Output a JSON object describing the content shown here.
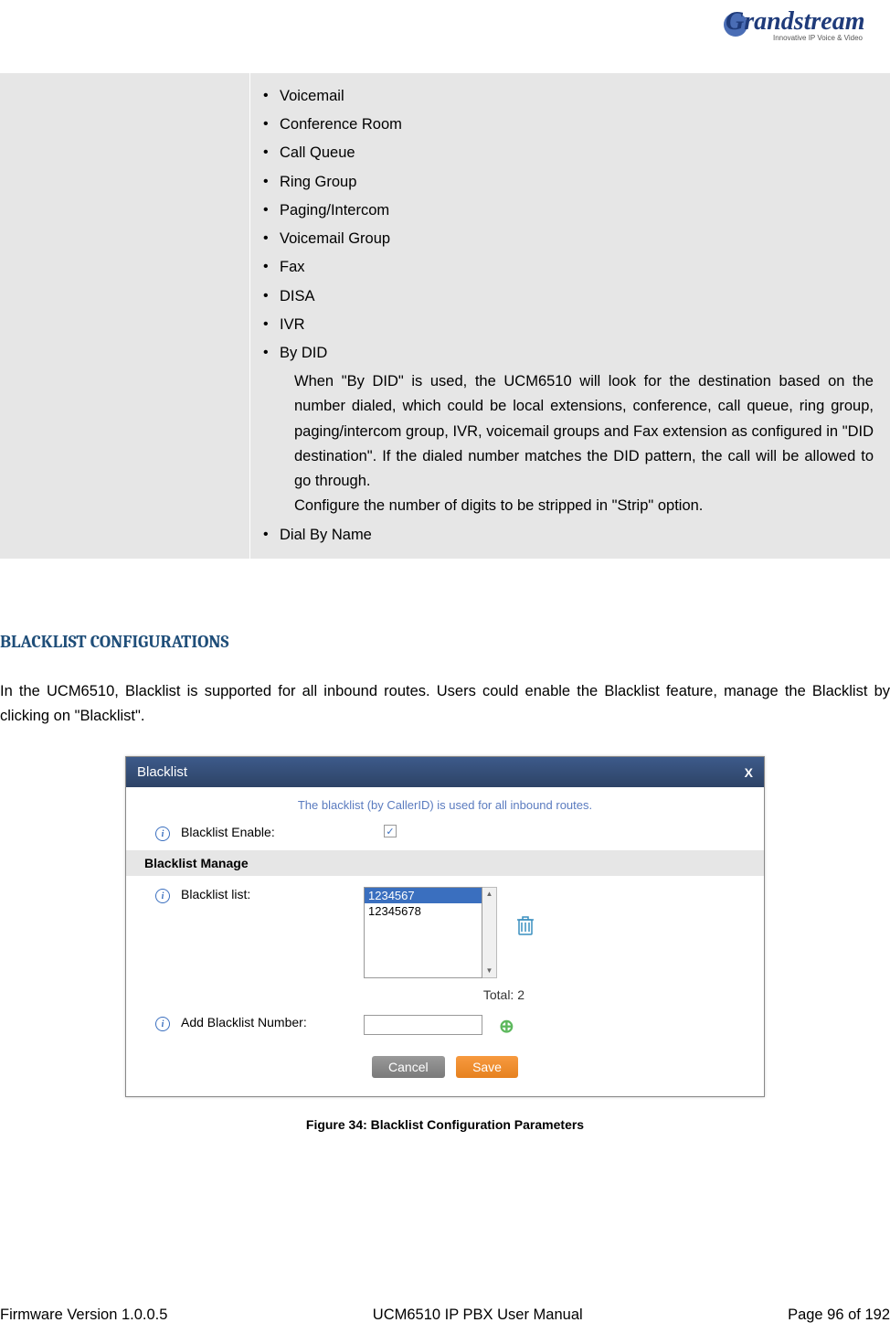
{
  "logo": {
    "brand": "Grandstream",
    "tagline": "Innovative IP Voice & Video"
  },
  "bullet_items": [
    {
      "label": "Voicemail"
    },
    {
      "label": "Conference Room"
    },
    {
      "label": "Call Queue"
    },
    {
      "label": "Ring Group"
    },
    {
      "label": "Paging/Intercom"
    },
    {
      "label": "Voicemail Group"
    },
    {
      "label": "Fax"
    },
    {
      "label": "DISA"
    },
    {
      "label": "IVR"
    },
    {
      "label": "By DID"
    },
    {
      "label": "Dial By Name"
    }
  ],
  "by_did_desc_1": "When \"By DID\" is used, the UCM6510 will look for the destination based on the number dialed, which could be local extensions, conference, call queue, ring group, paging/intercom group, IVR, voicemail groups and Fax extension as configured in \"DID destination\". If the dialed number matches the DID pattern, the call will be allowed to go through.",
  "by_did_desc_2": "Configure the number of digits to be stripped in \"Strip\" option.",
  "section_heading": "BLACKLIST CONFIGURATIONS",
  "intro_text": "In the UCM6510, Blacklist is supported for all inbound routes. Users could enable the Blacklist feature, manage the Blacklist by clicking on \"Blacklist\".",
  "dialog": {
    "title": "Blacklist",
    "close": "X",
    "desc": "The blacklist (by CallerID) is used for all inbound routes.",
    "enable_label": "Blacklist Enable:",
    "manage_header": "Blacklist Manage",
    "list_label": "Blacklist list:",
    "list_items": [
      "1234567",
      "12345678"
    ],
    "total_label": "Total: 2",
    "add_label": "Add Blacklist Number:",
    "cancel": "Cancel",
    "save": "Save"
  },
  "figure_caption": "Figure 34: Blacklist Configuration Parameters",
  "footer": {
    "left": "Firmware Version 1.0.0.5",
    "center": "UCM6510 IP PBX User Manual",
    "right": "Page 96 of 192"
  }
}
